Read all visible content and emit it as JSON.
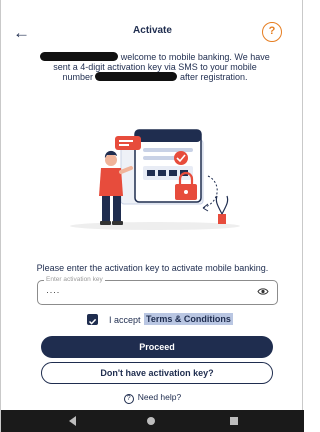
{
  "header": {
    "back_icon": "arrow-left-icon",
    "title": "Activate",
    "help_glyph": "?"
  },
  "intro": {
    "part1": "welcome to mobile banking. We have",
    "part2": "sent a 4-digit activation key via SMS to your mobile",
    "part3": "number",
    "part4": "after registration."
  },
  "prompt": "Please enter the activation key to activate mobile banking.",
  "activation_field": {
    "label": "Enter activation key",
    "value": "····"
  },
  "terms": {
    "checked": true,
    "text": "I accept",
    "link": "Terms & Conditions"
  },
  "buttons": {
    "proceed": "Proceed",
    "no_key": "Don't have activation key?"
  },
  "need_help": {
    "icon_glyph": "?",
    "label": "Need help?"
  },
  "colors": {
    "primary": "#1f2d4f",
    "accent": "#e67e22",
    "alert_red": "#e74c3c"
  }
}
